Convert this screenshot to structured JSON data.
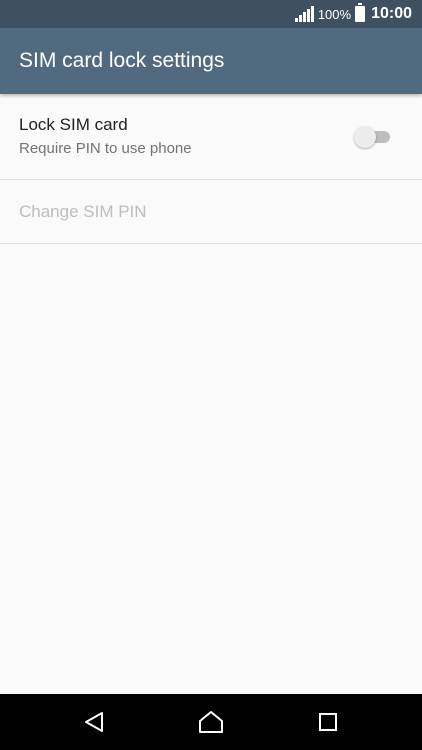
{
  "status_bar": {
    "battery_percent": "100%",
    "time": "10:00",
    "icons": [
      "signal-icon",
      "battery-icon"
    ]
  },
  "app_bar": {
    "title": "SIM card lock settings"
  },
  "settings": {
    "lock_sim": {
      "title": "Lock SIM card",
      "subtitle": "Require PIN to use phone",
      "toggle_state": "off"
    },
    "change_pin": {
      "label": "Change SIM PIN",
      "enabled": false
    }
  },
  "nav_bar": {
    "buttons": [
      "back-icon",
      "home-icon",
      "recents-icon"
    ]
  },
  "colors": {
    "status_bar": "#3f5161",
    "app_bar": "#526a7f",
    "background": "#fafafa",
    "disabled_text": "#bdbdbd"
  }
}
